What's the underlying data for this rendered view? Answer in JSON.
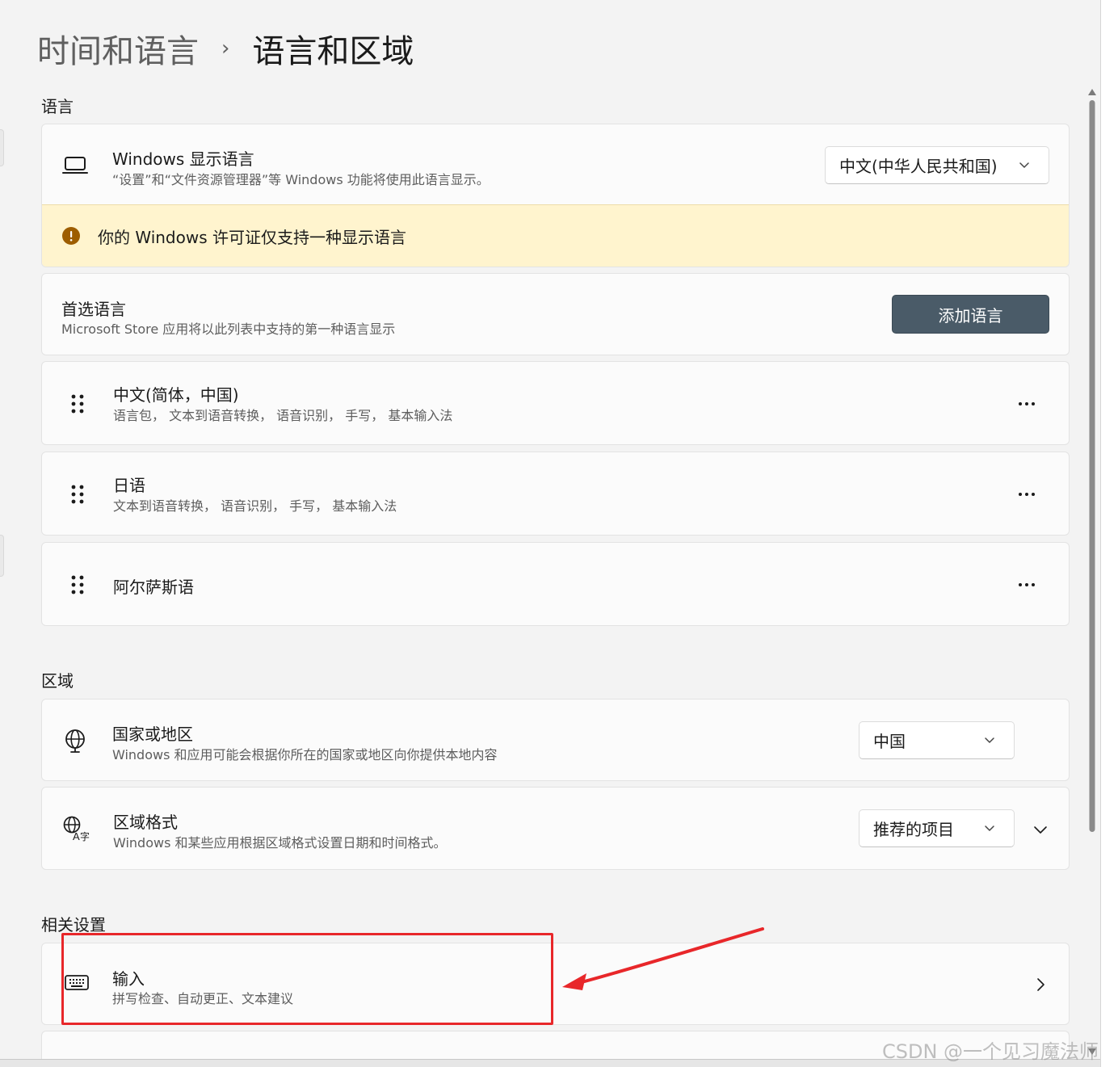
{
  "breadcrumb": {
    "parent": "时间和语言",
    "separator": "›",
    "current": "语言和区域"
  },
  "language_section": {
    "heading": "语言",
    "display_language": {
      "title": "Windows 显示语言",
      "description": "“设置”和“文件资源管理器”等 Windows 功能将使用此语言显示。",
      "selected": "中文(中华人民共和国)",
      "icon": "laptop-icon"
    },
    "warning": {
      "text": "你的 Windows 许可证仅支持一种显示语言",
      "icon": "warning-icon",
      "color": "#9d5d00",
      "background": "#fff4ce"
    },
    "preferred": {
      "title": "首选语言",
      "description": "Microsoft Store 应用将以此列表中支持的第一种语言显示",
      "add_button": "添加语言"
    },
    "languages": [
      {
        "name": "中文(简体，中国)",
        "features": "语言包， 文本到语音转换， 语音识别， 手写， 基本输入法"
      },
      {
        "name": "日语",
        "features": "文本到语音转换， 语音识别， 手写， 基本输入法"
      },
      {
        "name": "阿尔萨斯语",
        "features": ""
      }
    ]
  },
  "region_section": {
    "heading": "区域",
    "country": {
      "title": "国家或地区",
      "description": "Windows 和应用可能会根据你所在的国家或地区向你提供本地内容",
      "selected": "中国",
      "icon": "globe-icon"
    },
    "format": {
      "title": "区域格式",
      "description": "Windows 和某些应用根据区域格式设置日期和时间格式。",
      "selected": "推荐的项目",
      "icon": "globe-language-icon"
    }
  },
  "related_section": {
    "heading": "相关设置",
    "typing": {
      "title": "输入",
      "description": "拼写检查、自动更正、文本建议",
      "icon": "keyboard-icon"
    }
  },
  "annotation": {
    "color": "#e8272a"
  },
  "watermark": "CSDN @一个见习魔法师"
}
